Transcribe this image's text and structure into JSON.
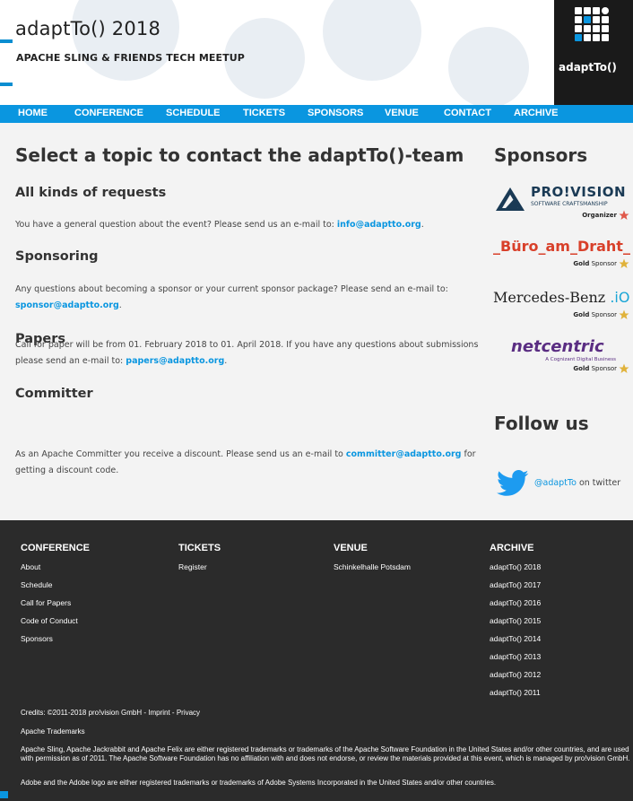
{
  "header": {
    "title": "adaptTo() 2018",
    "subtitle": "APACHE SLING & FRIENDS TECH MEETUP",
    "logo_text": "adaptTo()"
  },
  "nav": {
    "items": [
      "HOME",
      "CONFERENCE",
      "SCHEDULE",
      "TICKETS",
      "SPONSORS",
      "VENUE",
      "CONTACT",
      "ARCHIVE"
    ]
  },
  "main": {
    "heading": "Select a topic to contact the adaptTo()-team",
    "sections": [
      {
        "title": "All kinds of requests",
        "text_before": "You have a general question about the event? Please send us an e-mail to: ",
        "email": "info@adaptto.org",
        "text_after": "."
      },
      {
        "title": "Sponsoring",
        "text_before": "Any questions about becoming a sponsor or your current sponsor package? Please send an e-mail to: ",
        "email": "sponsor@adaptto.org",
        "text_after": "."
      },
      {
        "title": "Papers",
        "text_before": "Call for paper will be from 01. February 2018 to 01. April 2018. If you have any questions about submissions please send an e-mail to: ",
        "email": "papers@adaptto.org",
        "text_after": "."
      },
      {
        "title": "Committer",
        "text_before": "As an Apache Committer you receive a discount. Please send us an e-mail to ",
        "email": "committer@adaptto.org",
        "text_after": " for getting a discount code."
      }
    ]
  },
  "sidebar": {
    "sponsors_heading": "Sponsors",
    "sponsors": [
      {
        "name": "PRO!VISION",
        "tagline": "SOFTWARE CRAFTSMANSHIP",
        "level": "Organizer",
        "level_suffix": "",
        "star_color": "#e0584a"
      },
      {
        "name": "_Büro_am_Draht_",
        "level": "Gold",
        "level_suffix": " Sponsor",
        "star_color": "#e0b23a"
      },
      {
        "name": "Mercedes-Benz",
        "name_suffix": ".iO",
        "level": "Gold",
        "level_suffix": " Sponsor",
        "star_color": "#e0b23a"
      },
      {
        "name": "netcentric",
        "tagline": "A Cognizant Digital Business",
        "level": "Gold",
        "level_suffix": " Sponsor",
        "star_color": "#e0b23a"
      }
    ],
    "follow_heading": "Follow us",
    "twitter_handle": "@adaptTo",
    "twitter_suffix": " on twitter"
  },
  "footer": {
    "columns": [
      {
        "title": "CONFERENCE",
        "links": [
          "About",
          "Schedule",
          "Call for Papers",
          "Code of Conduct",
          "Sponsors"
        ]
      },
      {
        "title": "TICKETS",
        "links": [
          "Register"
        ]
      },
      {
        "title": "VENUE",
        "links": [
          "Schinkelhalle Potsdam"
        ]
      },
      {
        "title": "ARCHIVE",
        "links": [
          "adaptTo() 2018",
          "adaptTo() 2017",
          "adaptTo() 2016",
          "adaptTo() 2015",
          "adaptTo() 2014",
          "adaptTo() 2013",
          "adaptTo() 2012",
          "adaptTo() 2011"
        ]
      }
    ],
    "credits_prefix": "Credits: ©2011-2018 pro!vision GmbH - ",
    "imprint": "Imprint",
    "sep": " - ",
    "privacy": "Privacy",
    "trademarks_title": "Apache Trademarks",
    "apache_text": "Apache Sling, Apache Jackrabbit and Apache Felix are either registered trademarks or trademarks of the Apache Software Foundation in the United States and/or other countries, and are used with permission as of 2011. The Apache Software Foundation has no affiliation with and does not endorse, or review the materials provided at this event, which is managed by pro!vision GmbH.",
    "adobe_text": "Adobe and the Adobe logo are either registered trademarks or trademarks of Adobe Systems Incorporated in the United States and/or other countries."
  },
  "colors": {
    "accent": "#0a96e0",
    "footer_bg": "#2b2b2b",
    "main_bg": "#f3f3f3"
  }
}
